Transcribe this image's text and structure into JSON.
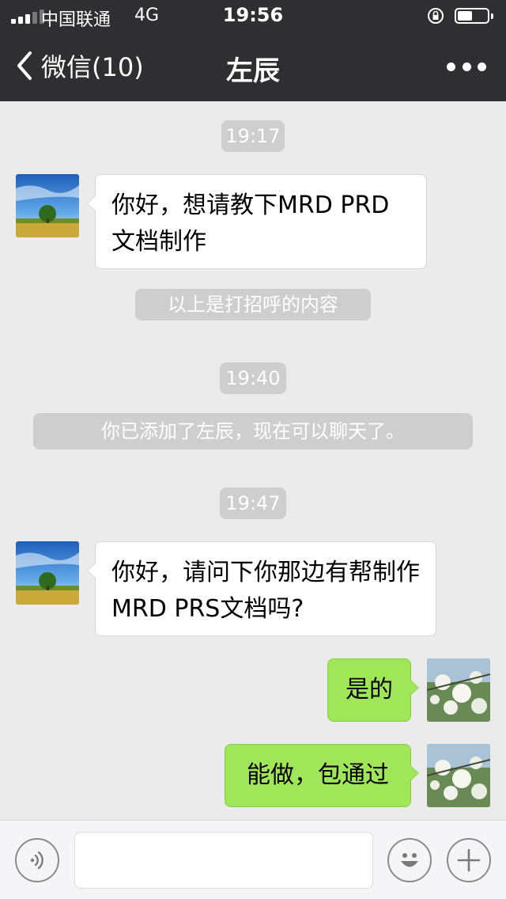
{
  "status_bar": {
    "carrier": "中国联通",
    "network": "4G",
    "time": "19:56"
  },
  "nav": {
    "back_label": "微信(10)",
    "title": "左辰",
    "more_icon": "more-dots-icon"
  },
  "messages": {
    "t1": "19:17",
    "m1": "你好，想请教下MRD  PRD文档制作",
    "s1": "以上是打招呼的内容",
    "t2": "19:40",
    "s2": "你已添加了左辰，现在可以聊天了。",
    "t3": "19:47",
    "m2": "你好，请问下你那边有帮制作MRD  PRS文档吗?",
    "m3": "是的",
    "m4": "能做，包通过"
  },
  "input_bar": {
    "voice_icon": "voice-icon",
    "emoji_icon": "emoji-icon",
    "plus_icon": "plus-icon",
    "placeholder": ""
  },
  "colors": {
    "nav_bg": "#2f2f33",
    "chat_bg": "#ebebeb",
    "outgoing_bubble": "#9fe658",
    "incoming_bubble": "#ffffff",
    "system_pill": "#cecece"
  }
}
